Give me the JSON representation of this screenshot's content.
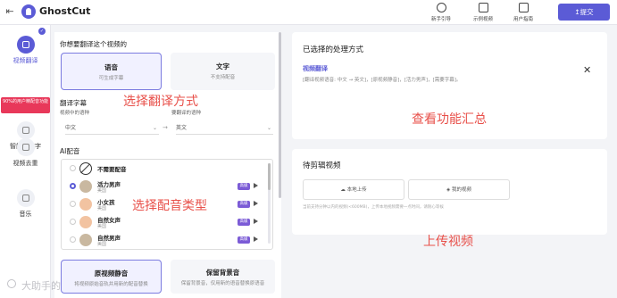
{
  "header": {
    "back_glyph": "⇤",
    "brand": "GhostCut",
    "nav": [
      {
        "label": "新手引导",
        "icon": "help-icon"
      },
      {
        "label": "示例视频",
        "icon": "play-video-icon"
      },
      {
        "label": "用户指南",
        "icon": "monitor-icon"
      }
    ],
    "submit_label": "↥提交",
    "colors": {
      "accent": "#5b5bd6"
    }
  },
  "sidebar": {
    "items": [
      {
        "label": "视频翻译",
        "icon": "translate-icon",
        "active": true
      },
      {
        "label": "智能去文字",
        "icon": "erase-text-icon"
      },
      {
        "label": "视频去重",
        "icon": "dedupe-icon"
      },
      {
        "label": "音乐",
        "icon": "music-icon"
      }
    ],
    "promo": "90%的用户精配音功能"
  },
  "left_panel": {
    "section_title": "你想要翻译这个视频的",
    "options": [
      {
        "title": "语音",
        "sub": "可生成字幕"
      },
      {
        "title": "文字",
        "sub": "不支持配音"
      }
    ],
    "subtitle_section": "翻译字幕",
    "src_lang_label": "视频中的语种",
    "tgt_lang_label": "要翻译的语种",
    "src_lang": "中文",
    "tgt_lang": "英文",
    "dub_section": "AI配音",
    "voices": [
      {
        "name": "不需要配音",
        "sub": ""
      },
      {
        "name": "活力男声",
        "sub": "美国",
        "tag": "高级"
      },
      {
        "name": "小女孩",
        "sub": "美国",
        "tag": "高级"
      },
      {
        "name": "自然女声",
        "sub": "美国",
        "tag": "高级"
      },
      {
        "name": "自然男声",
        "sub": "美国",
        "tag": "高级"
      }
    ],
    "bottom_options": [
      {
        "title": "原视频静音",
        "sub": "将视频原始音轨并用新的配音替换"
      },
      {
        "title": "保留背景音",
        "sub": "保留背景音，仅用新的语音替换原语音"
      }
    ]
  },
  "right_top": {
    "title": "已选择的处理方式",
    "chosen": "视频翻译",
    "desc": "[翻译视频语音: 中文 → 英文]，[原视频静音]，[活力男声]，[需要字幕]。"
  },
  "right_bottom": {
    "title": "待剪辑视频",
    "local_upload": "本地上传",
    "my_videos": "我的视频",
    "note": "当前支持分钟以内的视频(<600MB)，上传本地视频需要一点时间，请耐心等候"
  },
  "annotations": {
    "pick_method": "选择翻译方式",
    "pick_voice": "选择配音类型",
    "summary": "查看功能汇总",
    "upload": "上传视频"
  },
  "watermark": "大助手的"
}
